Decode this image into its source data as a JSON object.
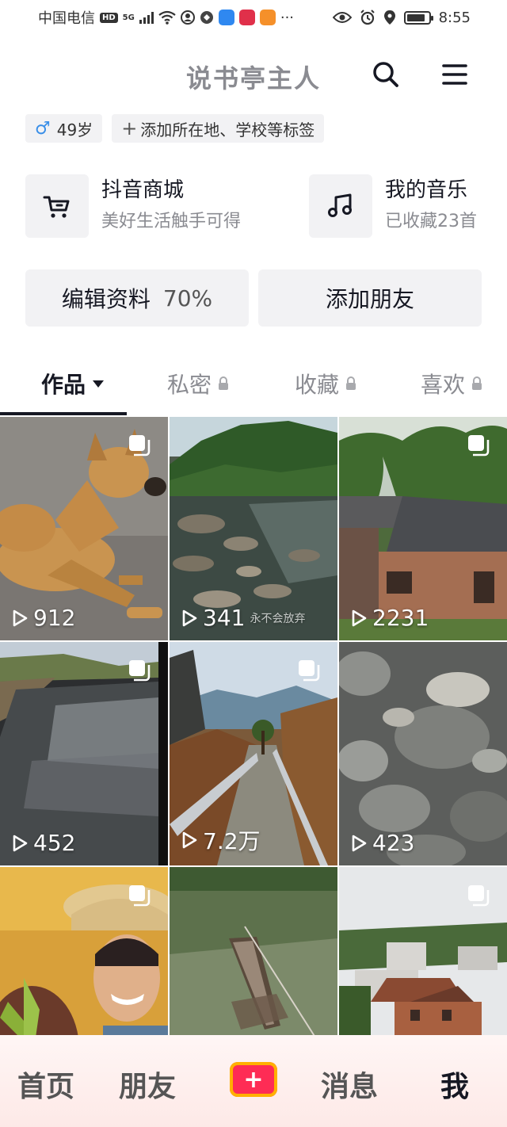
{
  "status_bar": {
    "carrier": "中国电信",
    "hd_badge": "HD",
    "network": "5G",
    "more": "···",
    "time": "8:55",
    "battery_percent": 85
  },
  "header": {
    "title": "说书亭主人",
    "search_icon": "search-icon",
    "menu_icon": "menu-icon"
  },
  "tags": {
    "gender_symbol": "♂",
    "age": "49岁",
    "add_plus": "+",
    "add_label": "添加所在地、学校等标签"
  },
  "shortcuts": {
    "mall": {
      "title": "抖音商城",
      "subtitle": "美好生活触手可得",
      "icon": "cart-icon"
    },
    "music": {
      "title": "我的音乐",
      "subtitle": "已收藏23首",
      "icon": "music-note-icon"
    }
  },
  "buttons": {
    "edit_profile": "编辑资料",
    "edit_progress": "70%",
    "add_friend": "添加朋友"
  },
  "tabs": [
    {
      "label": "作品",
      "active": true
    },
    {
      "label": "私密",
      "locked": true
    },
    {
      "label": "收藏",
      "locked": true
    },
    {
      "label": "喜欢",
      "locked": true
    }
  ],
  "videos": [
    {
      "subject": "dog",
      "views": "912",
      "multi": true
    },
    {
      "subject": "river-rocks",
      "views": "341",
      "overlay_text": "永不会放弃",
      "multi": false
    },
    {
      "subject": "village-smoke",
      "views": "2231",
      "multi": true
    },
    {
      "subject": "river-shimmer",
      "views": "452",
      "multi": true
    },
    {
      "subject": "mountain-path",
      "views": "7.2万",
      "multi": true
    },
    {
      "subject": "boulders",
      "views": "423",
      "multi": false
    },
    {
      "subject": "farmer-woman",
      "views": "",
      "multi": true
    },
    {
      "subject": "boat",
      "views": "",
      "multi": false
    },
    {
      "subject": "village-houses",
      "views": "",
      "multi": true
    }
  ],
  "bottom_nav": {
    "home": "首页",
    "friends": "朋友",
    "plus": "+",
    "messages": "消息",
    "me": "我"
  },
  "colors": {
    "accent": "#fe2c55",
    "plus_border": "#ffb000",
    "text_primary": "#161823",
    "text_secondary": "#8a8b91",
    "chip_bg": "#f2f2f4",
    "male": "#3a8fe8"
  }
}
